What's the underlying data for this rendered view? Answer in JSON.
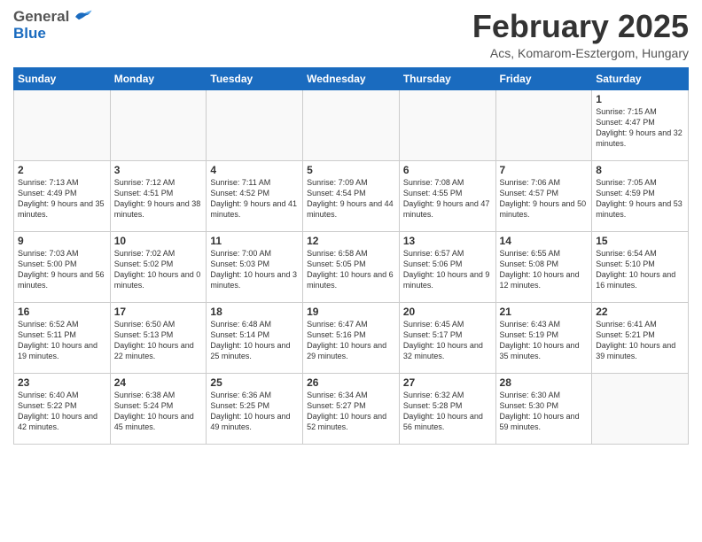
{
  "header": {
    "logo_general": "General",
    "logo_blue": "Blue",
    "month_title": "February 2025",
    "location": "Acs, Komarom-Esztergom, Hungary"
  },
  "days_of_week": [
    "Sunday",
    "Monday",
    "Tuesday",
    "Wednesday",
    "Thursday",
    "Friday",
    "Saturday"
  ],
  "weeks": [
    [
      {
        "day": "",
        "info": ""
      },
      {
        "day": "",
        "info": ""
      },
      {
        "day": "",
        "info": ""
      },
      {
        "day": "",
        "info": ""
      },
      {
        "day": "",
        "info": ""
      },
      {
        "day": "",
        "info": ""
      },
      {
        "day": "1",
        "info": "Sunrise: 7:15 AM\nSunset: 4:47 PM\nDaylight: 9 hours and 32 minutes."
      }
    ],
    [
      {
        "day": "2",
        "info": "Sunrise: 7:13 AM\nSunset: 4:49 PM\nDaylight: 9 hours and 35 minutes."
      },
      {
        "day": "3",
        "info": "Sunrise: 7:12 AM\nSunset: 4:51 PM\nDaylight: 9 hours and 38 minutes."
      },
      {
        "day": "4",
        "info": "Sunrise: 7:11 AM\nSunset: 4:52 PM\nDaylight: 9 hours and 41 minutes."
      },
      {
        "day": "5",
        "info": "Sunrise: 7:09 AM\nSunset: 4:54 PM\nDaylight: 9 hours and 44 minutes."
      },
      {
        "day": "6",
        "info": "Sunrise: 7:08 AM\nSunset: 4:55 PM\nDaylight: 9 hours and 47 minutes."
      },
      {
        "day": "7",
        "info": "Sunrise: 7:06 AM\nSunset: 4:57 PM\nDaylight: 9 hours and 50 minutes."
      },
      {
        "day": "8",
        "info": "Sunrise: 7:05 AM\nSunset: 4:59 PM\nDaylight: 9 hours and 53 minutes."
      }
    ],
    [
      {
        "day": "9",
        "info": "Sunrise: 7:03 AM\nSunset: 5:00 PM\nDaylight: 9 hours and 56 minutes."
      },
      {
        "day": "10",
        "info": "Sunrise: 7:02 AM\nSunset: 5:02 PM\nDaylight: 10 hours and 0 minutes."
      },
      {
        "day": "11",
        "info": "Sunrise: 7:00 AM\nSunset: 5:03 PM\nDaylight: 10 hours and 3 minutes."
      },
      {
        "day": "12",
        "info": "Sunrise: 6:58 AM\nSunset: 5:05 PM\nDaylight: 10 hours and 6 minutes."
      },
      {
        "day": "13",
        "info": "Sunrise: 6:57 AM\nSunset: 5:06 PM\nDaylight: 10 hours and 9 minutes."
      },
      {
        "day": "14",
        "info": "Sunrise: 6:55 AM\nSunset: 5:08 PM\nDaylight: 10 hours and 12 minutes."
      },
      {
        "day": "15",
        "info": "Sunrise: 6:54 AM\nSunset: 5:10 PM\nDaylight: 10 hours and 16 minutes."
      }
    ],
    [
      {
        "day": "16",
        "info": "Sunrise: 6:52 AM\nSunset: 5:11 PM\nDaylight: 10 hours and 19 minutes."
      },
      {
        "day": "17",
        "info": "Sunrise: 6:50 AM\nSunset: 5:13 PM\nDaylight: 10 hours and 22 minutes."
      },
      {
        "day": "18",
        "info": "Sunrise: 6:48 AM\nSunset: 5:14 PM\nDaylight: 10 hours and 25 minutes."
      },
      {
        "day": "19",
        "info": "Sunrise: 6:47 AM\nSunset: 5:16 PM\nDaylight: 10 hours and 29 minutes."
      },
      {
        "day": "20",
        "info": "Sunrise: 6:45 AM\nSunset: 5:17 PM\nDaylight: 10 hours and 32 minutes."
      },
      {
        "day": "21",
        "info": "Sunrise: 6:43 AM\nSunset: 5:19 PM\nDaylight: 10 hours and 35 minutes."
      },
      {
        "day": "22",
        "info": "Sunrise: 6:41 AM\nSunset: 5:21 PM\nDaylight: 10 hours and 39 minutes."
      }
    ],
    [
      {
        "day": "23",
        "info": "Sunrise: 6:40 AM\nSunset: 5:22 PM\nDaylight: 10 hours and 42 minutes."
      },
      {
        "day": "24",
        "info": "Sunrise: 6:38 AM\nSunset: 5:24 PM\nDaylight: 10 hours and 45 minutes."
      },
      {
        "day": "25",
        "info": "Sunrise: 6:36 AM\nSunset: 5:25 PM\nDaylight: 10 hours and 49 minutes."
      },
      {
        "day": "26",
        "info": "Sunrise: 6:34 AM\nSunset: 5:27 PM\nDaylight: 10 hours and 52 minutes."
      },
      {
        "day": "27",
        "info": "Sunrise: 6:32 AM\nSunset: 5:28 PM\nDaylight: 10 hours and 56 minutes."
      },
      {
        "day": "28",
        "info": "Sunrise: 6:30 AM\nSunset: 5:30 PM\nDaylight: 10 hours and 59 minutes."
      },
      {
        "day": "",
        "info": ""
      }
    ]
  ]
}
